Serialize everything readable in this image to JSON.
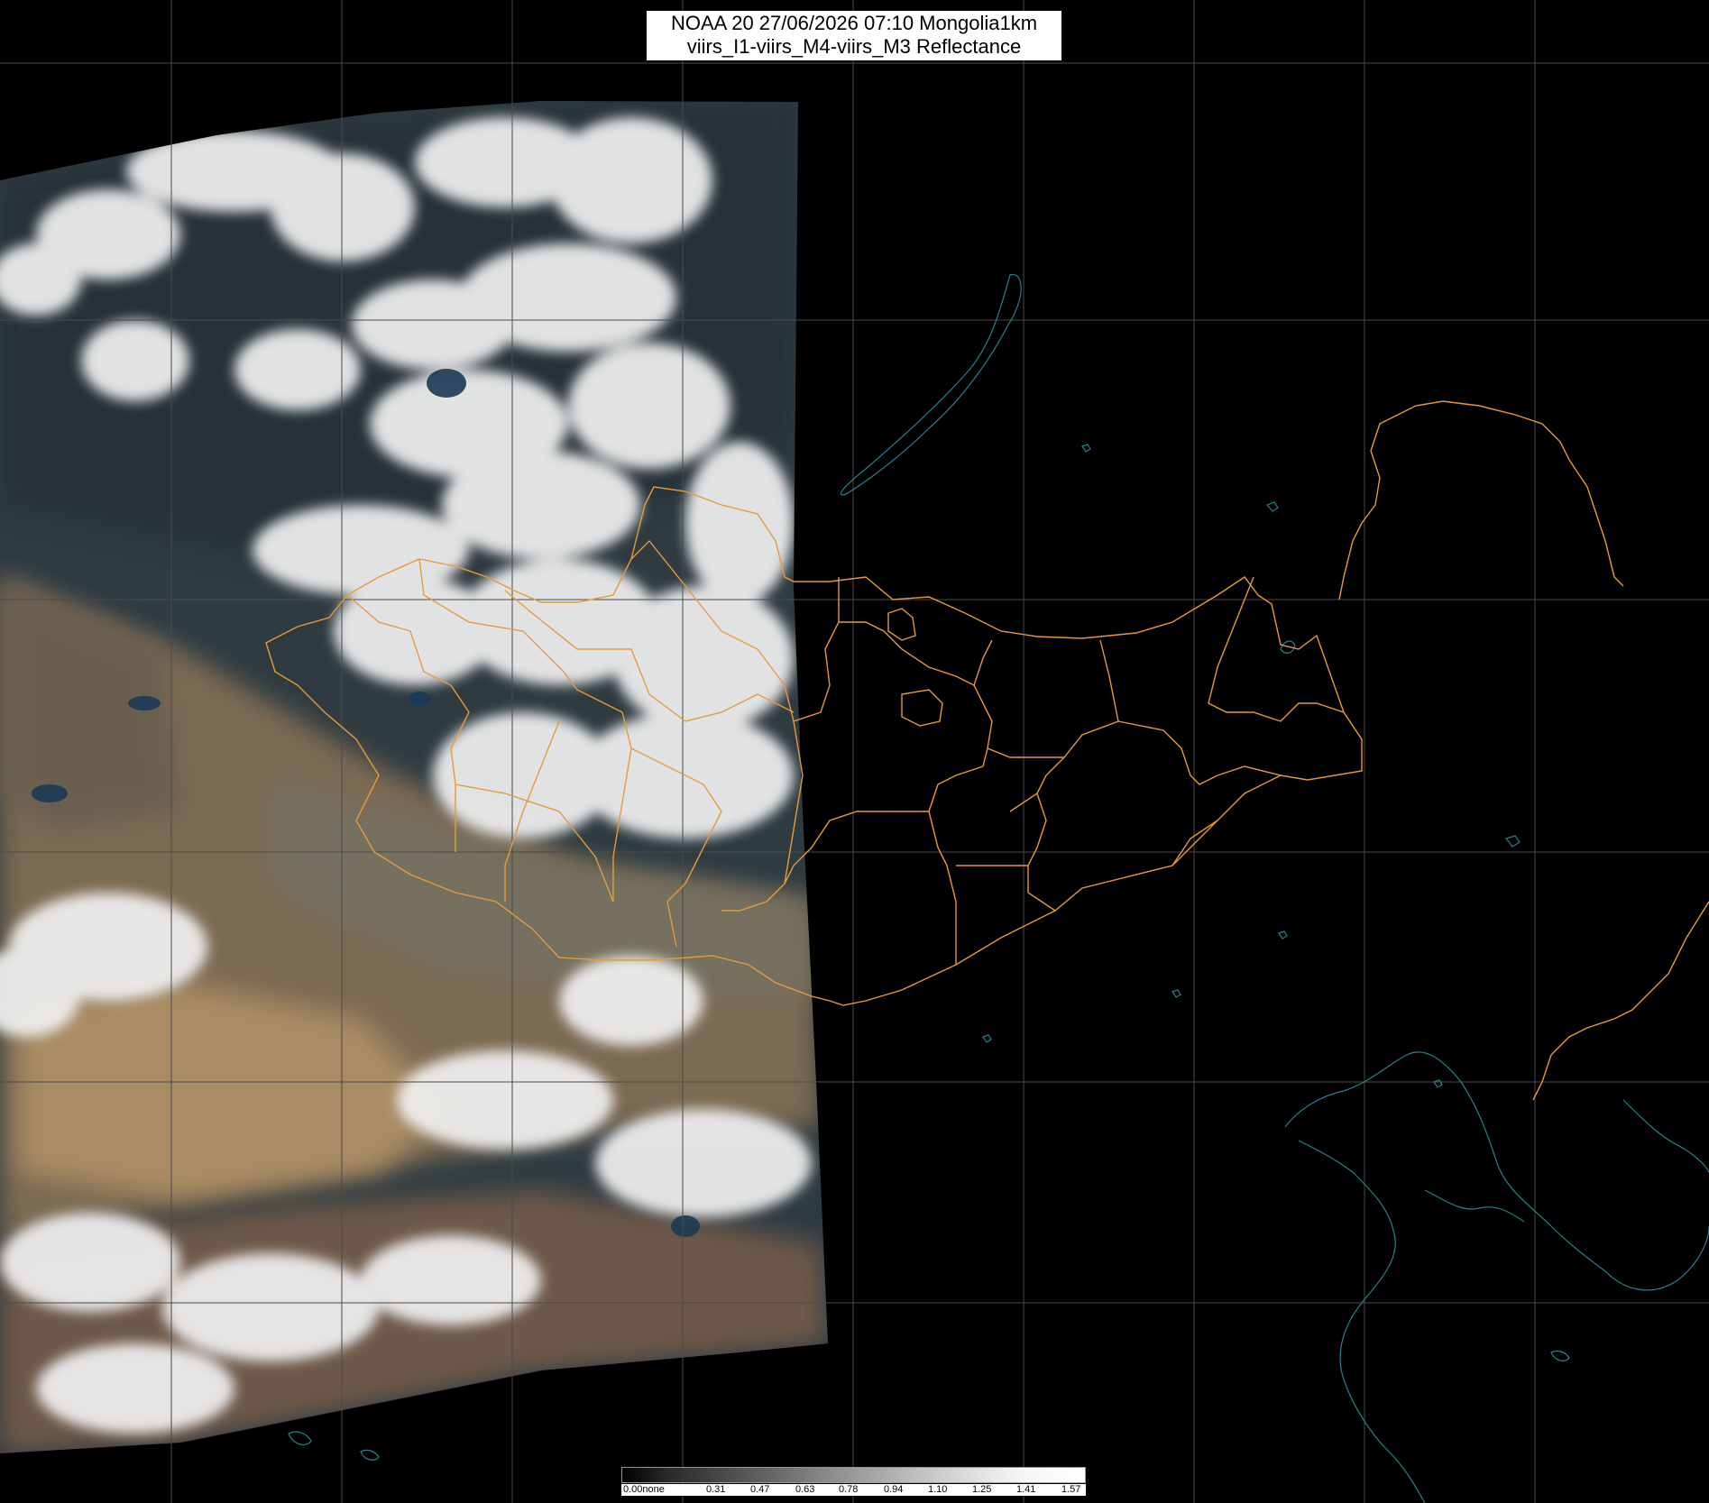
{
  "title": {
    "line1": "NOAA 20 27/06/2026 07:10 Mongolia1km",
    "line2": "viirs_I1-viirs_M4-viirs_M3 Reflectance"
  },
  "colorbar": {
    "ticks": [
      "0.00none",
      "0.31",
      "0.47",
      "0.63",
      "0.78",
      "0.94",
      "1.10",
      "1.25",
      "1.41",
      "1.57"
    ]
  },
  "colors": {
    "background": "#000000",
    "graticule": "#4a4a4a",
    "border": "#e89a3a",
    "coastline": "#2d7f8f",
    "cloud": "#f2f2f2",
    "desert": "#9c8463",
    "forest": "#2c3a3f"
  }
}
